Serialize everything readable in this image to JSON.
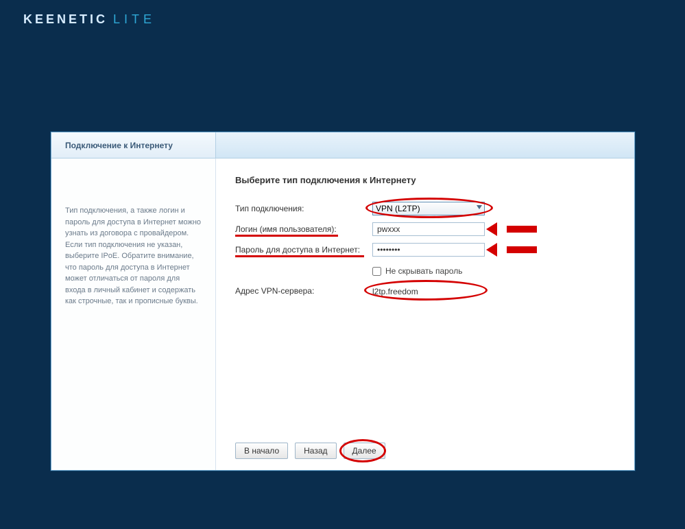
{
  "brand": {
    "name": "KEENETIC",
    "variant": "LITE"
  },
  "tab": {
    "title": "Подключение к Интернету"
  },
  "sidebar": {
    "help_text": "Тип подключения, а также логин и пароль для доступа в Интернет можно узнать из договора с провайдером. Если тип подключения не указан, выберите IPoE. Обратите внимание, что пароль для доступа в Интернет может отличаться от пароля для входа в личный кабинет и содержать как строчные, так и прописные буквы."
  },
  "main": {
    "heading": "Выберите тип подключения к Интернету",
    "labels": {
      "type": "Тип подключения:",
      "login": "Логин (имя пользователя):",
      "password": "Пароль для доступа в Интернет:",
      "show_pw": "Не скрывать пароль",
      "vpn": "Адрес VPN-сервера:"
    },
    "values": {
      "type_selected": "VPN (L2TP)",
      "login": "pwxxx",
      "password": "••••••••",
      "vpn_server": "l2tp.freedom"
    }
  },
  "buttons": {
    "start": "В начало",
    "back": "Назад",
    "next": "Далее"
  },
  "annotation_color": "#d40000"
}
